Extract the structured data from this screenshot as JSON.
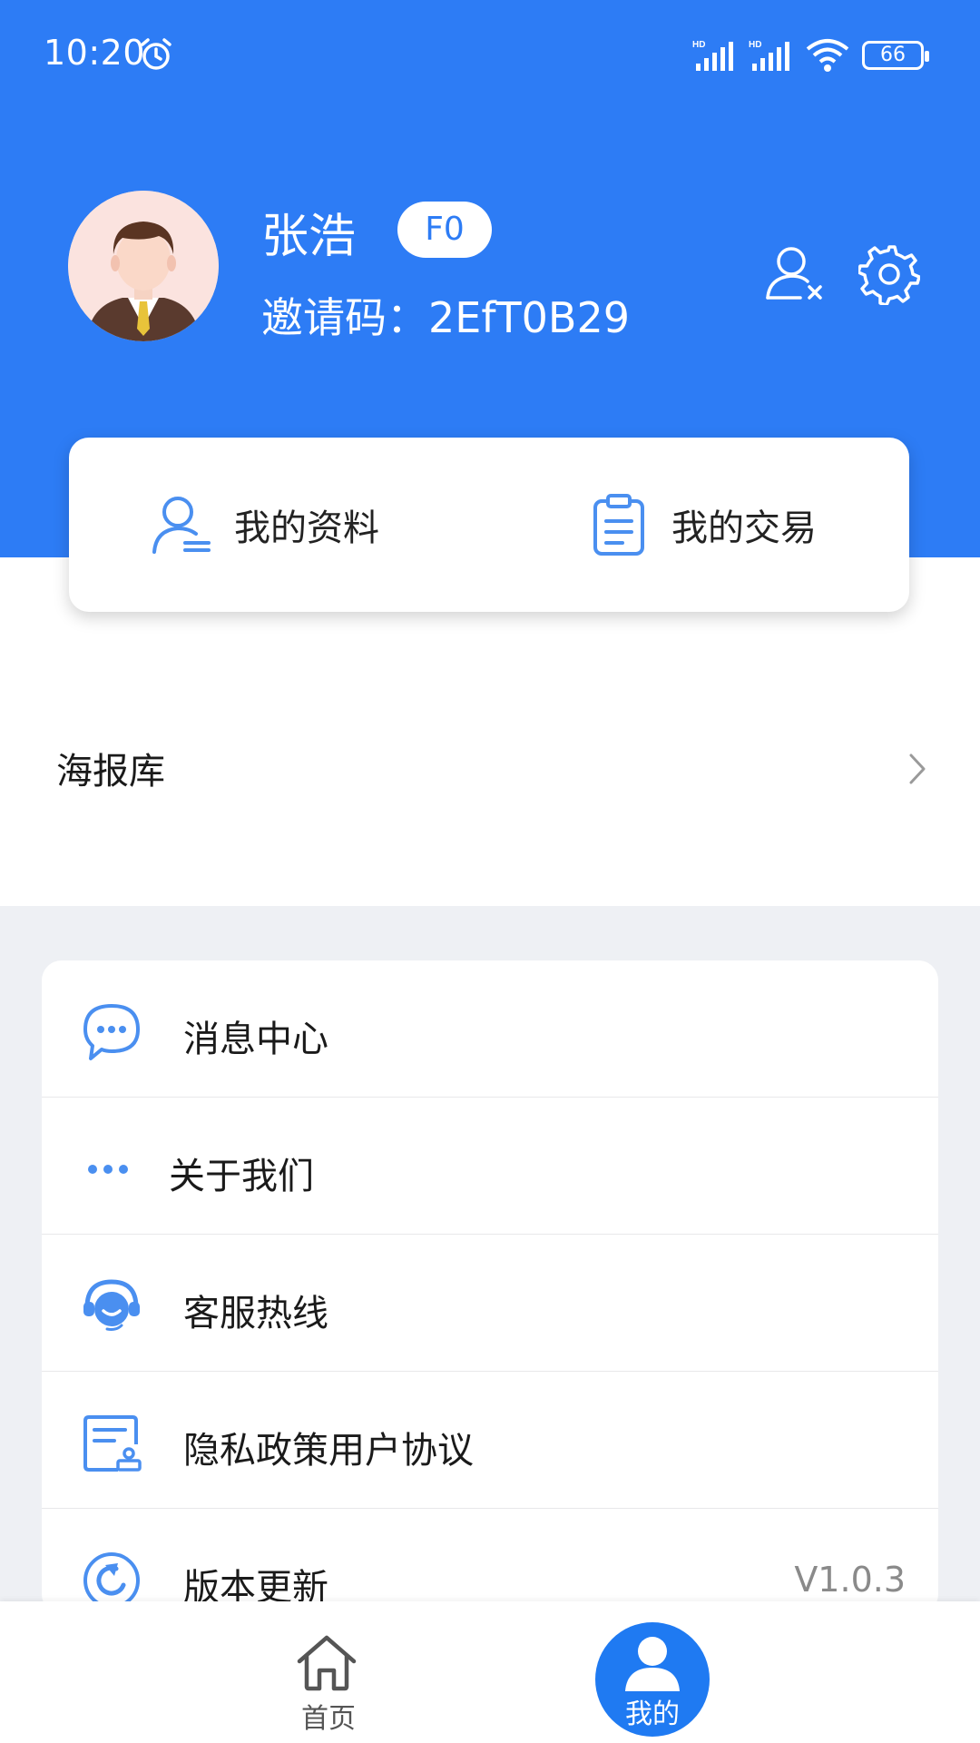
{
  "status_bar": {
    "time": "10:20",
    "battery": "66"
  },
  "profile": {
    "name": "张浩",
    "level": "F0",
    "invite_code": "邀请码：2EfT0B29"
  },
  "quick_actions": {
    "my_profile": "我的资料",
    "my_trades": "我的交易"
  },
  "poster_library": {
    "label": "海报库"
  },
  "menu": {
    "items": [
      {
        "label": "消息中心",
        "icon": "chat-bubble-icon"
      },
      {
        "label": "关于我们",
        "icon": "more-dots-icon"
      },
      {
        "label": "客服热线",
        "icon": "headset-icon"
      },
      {
        "label": "隐私政策用户协议",
        "icon": "document-stamp-icon"
      },
      {
        "label": "版本更新",
        "icon": "refresh-icon",
        "value": "V1.0.3"
      }
    ]
  },
  "tabbar": {
    "home": "首页",
    "mine": "我的"
  },
  "colors": {
    "primary": "#2d7cf5",
    "icon_blue": "#4a8ff0",
    "background_gray": "#eef0f4"
  }
}
